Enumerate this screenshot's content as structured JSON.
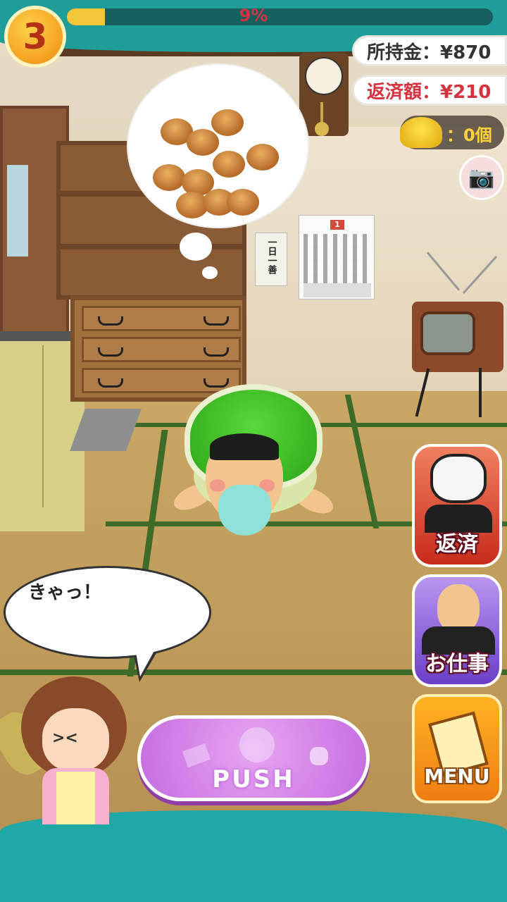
{
  "hud": {
    "level": "3",
    "progress_label": "9%",
    "progress_fraction": 0.09,
    "money_label": "所持金：¥870",
    "repay_label": "返済額：¥210",
    "shell_count_label": "：0個"
  },
  "calendar": {
    "month": "1"
  },
  "sign": {
    "text": "一日一善"
  },
  "side_buttons": {
    "repay": "返済",
    "work": "お仕事",
    "menu": "MENU"
  },
  "speech": {
    "text": "きゃっ！"
  },
  "push_button": {
    "label": "PUSH"
  },
  "icons": {
    "camera": "camera-icon",
    "shell": "shell-icon",
    "bun": "bun-icon"
  },
  "colors": {
    "hud_teal": "#1f9d99",
    "progress_text": "#d6333e",
    "push_purple": "#c56be0",
    "menu_orange": "#ee7d12"
  }
}
